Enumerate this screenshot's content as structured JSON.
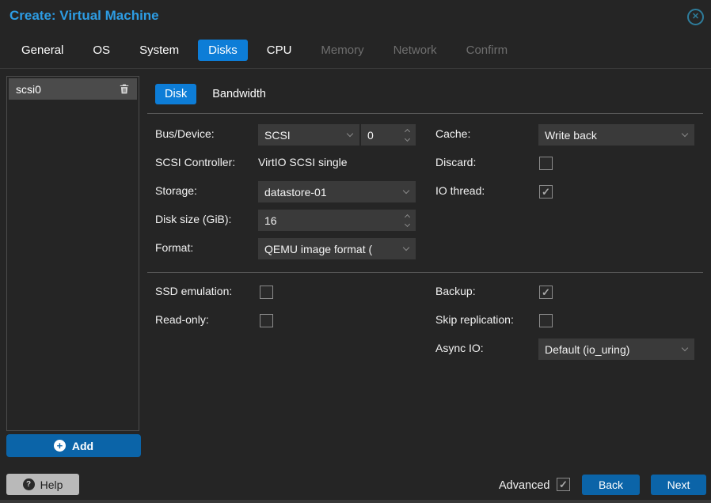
{
  "window": {
    "title": "Create: Virtual Machine"
  },
  "tabs": [
    {
      "label": "General",
      "state": "enabled"
    },
    {
      "label": "OS",
      "state": "enabled"
    },
    {
      "label": "System",
      "state": "enabled"
    },
    {
      "label": "Disks",
      "state": "active"
    },
    {
      "label": "CPU",
      "state": "enabled"
    },
    {
      "label": "Memory",
      "state": "disabled"
    },
    {
      "label": "Network",
      "state": "disabled"
    },
    {
      "label": "Confirm",
      "state": "disabled"
    }
  ],
  "sidebar": {
    "items": [
      {
        "label": "scsi0",
        "selected": true
      }
    ],
    "add_label": "Add"
  },
  "panel": {
    "subtabs": [
      {
        "label": "Disk",
        "state": "active"
      },
      {
        "label": "Bandwidth",
        "state": "normal"
      }
    ],
    "fields": {
      "bus_device": {
        "label": "Bus/Device:",
        "bus": "SCSI",
        "device": "0"
      },
      "scsi_controller": {
        "label": "SCSI Controller:",
        "value": "VirtIO SCSI single"
      },
      "storage": {
        "label": "Storage:",
        "value": "datastore-01"
      },
      "disk_size": {
        "label": "Disk size (GiB):",
        "value": "16"
      },
      "format": {
        "label": "Format:",
        "value": "QEMU image format ("
      },
      "cache": {
        "label": "Cache:",
        "value": "Write back"
      },
      "discard": {
        "label": "Discard:",
        "checked": false,
        "mark": ""
      },
      "io_thread": {
        "label": "IO thread:",
        "checked": true,
        "mark": "✓"
      },
      "ssd_emulation": {
        "label": "SSD emulation:",
        "checked": false,
        "mark": ""
      },
      "read_only": {
        "label": "Read-only:",
        "checked": false,
        "mark": ""
      },
      "backup": {
        "label": "Backup:",
        "checked": true,
        "mark": "✓"
      },
      "skip_replication": {
        "label": "Skip replication:",
        "checked": false,
        "mark": ""
      },
      "async_io": {
        "label": "Async IO:",
        "value": "Default (io_uring)"
      }
    }
  },
  "footer": {
    "help_label": "Help",
    "advanced_label": "Advanced",
    "advanced_checked": true,
    "advanced_mark": "✓",
    "back_label": "Back",
    "next_label": "Next"
  },
  "icons": {
    "close": "circle-x",
    "trash": "trash-can",
    "add": "plus-circle",
    "help": "question-circle",
    "combo": "chevron-down",
    "spinner": "chevron-up-down",
    "close_glyph": "✕",
    "plus_glyph": "+",
    "question_glyph": "?"
  },
  "colors": {
    "title_blue": "#2d9ce3",
    "active_tab_blue": "#0d7dd7",
    "button_blue": "#0b64a8",
    "field_bg": "#3a3a3a",
    "dialog_bg": "#252525",
    "close_teal": "#2e7d9c"
  }
}
